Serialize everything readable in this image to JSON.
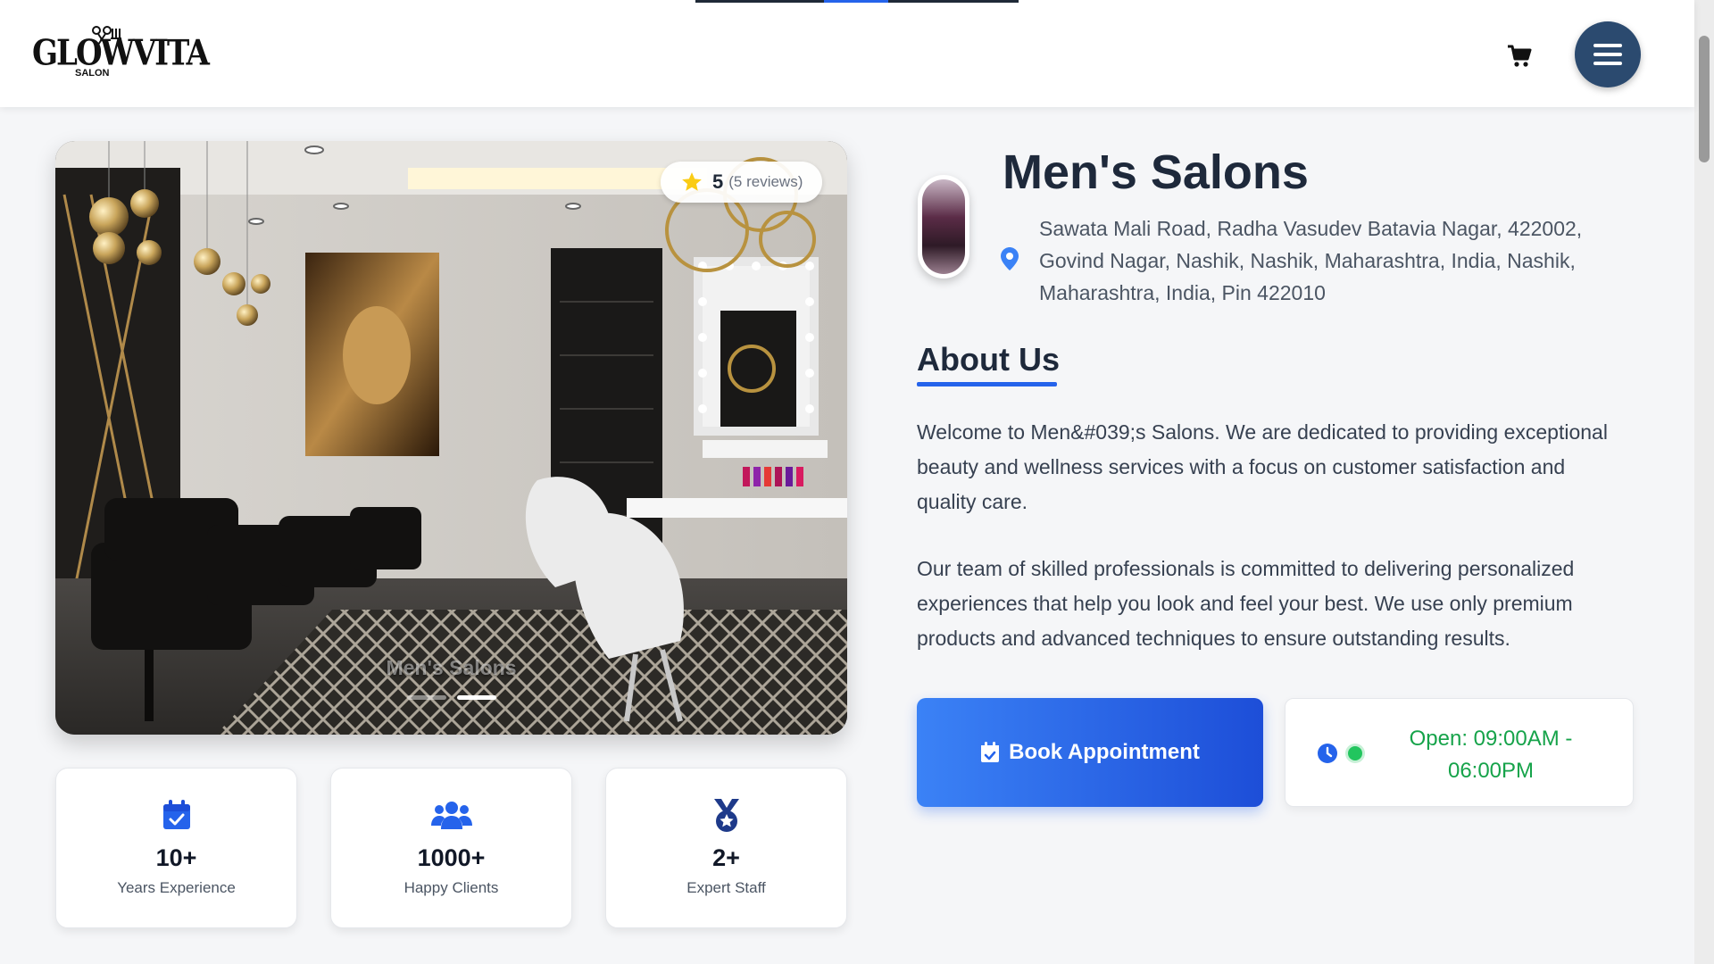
{
  "header": {
    "logo_text": "GLOWVITA",
    "logo_sub": "SALON",
    "cart_icon": "shopping-cart-icon",
    "menu_icon": "hamburger-menu-icon"
  },
  "hero": {
    "rating_value": "5",
    "rating_reviews": "(5 reviews)",
    "caption": "Men's Salons",
    "slides_count": 2,
    "active_slide": 2
  },
  "stats": [
    {
      "icon": "calendar-check-icon",
      "value": "10+",
      "label": "Years Experience"
    },
    {
      "icon": "users-icon",
      "value": "1000+",
      "label": "Happy Clients"
    },
    {
      "icon": "award-medal-icon",
      "value": "2+",
      "label": "Expert Staff"
    }
  ],
  "salon": {
    "name": "Men's Salons",
    "address": "Sawata Mali Road, Radha Vasudev Batavia Nagar, 422002, Govind Nagar, Nashik, Nashik, Maharashtra, India, Nashik, Maharashtra, India, Pin 422010"
  },
  "about": {
    "heading": "About Us",
    "paragraph1": "Welcome to Men&#039;s Salons. We are dedicated to providing exceptional beauty and wellness services with a focus on customer satisfaction and quality care.",
    "paragraph2": "Our team of skilled professionals is committed to delivering personalized experiences that help you look and feel your best. We use only premium products and advanced techniques to ensure outstanding results."
  },
  "actions": {
    "book_label": "Book Appointment",
    "hours_text": "Open: 09:00AM - 06:00PM"
  },
  "colors": {
    "accent": "#2563eb",
    "menu_button": "#2b4a6f",
    "open_status": "#16a34a"
  }
}
